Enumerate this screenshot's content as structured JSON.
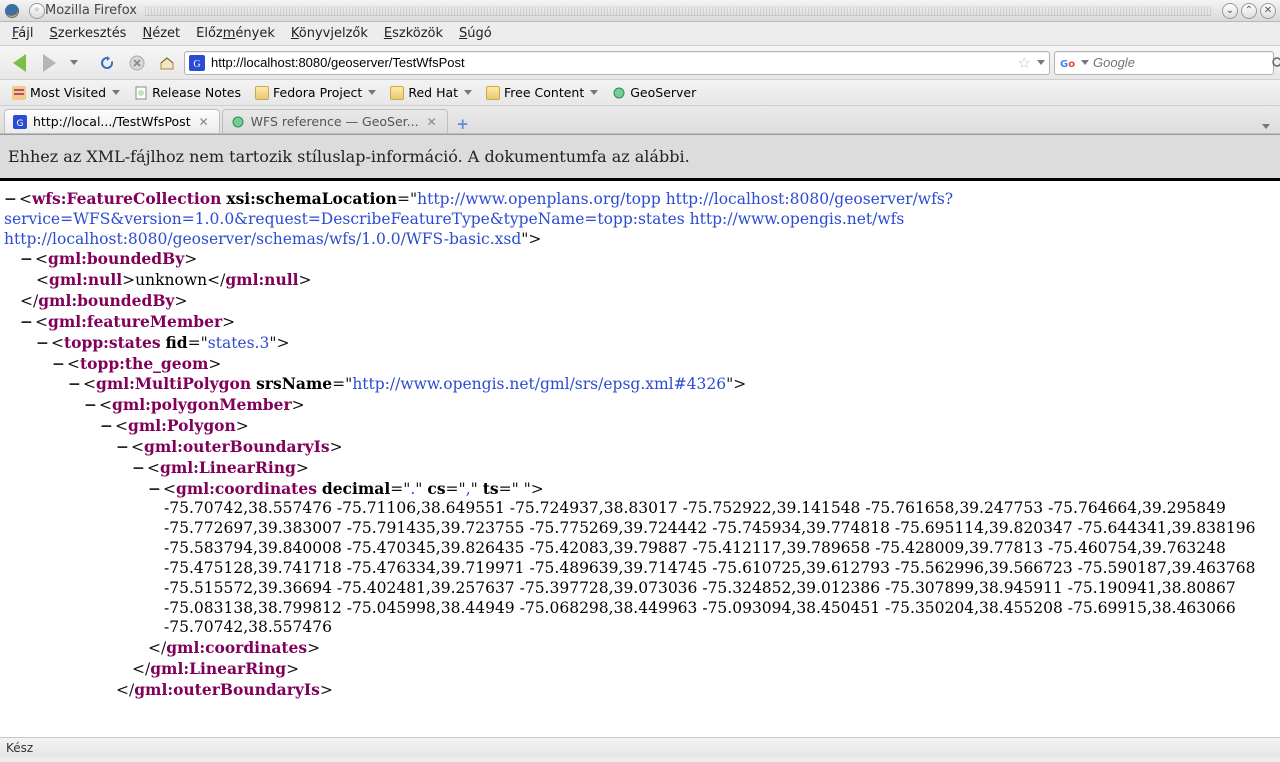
{
  "window": {
    "title": "Mozilla Firefox"
  },
  "menu": {
    "file": "Fájl",
    "edit": "Szerkesztés",
    "view": "Nézet",
    "history": "Előzmények",
    "bookmarks": "Könyvjelzők",
    "tools": "Eszközök",
    "help": "Súgó"
  },
  "url": "http://localhost:8080/geoserver/TestWfsPost",
  "search": {
    "placeholder": "Google"
  },
  "bookmarks": {
    "mostVisited": "Most Visited",
    "releaseNotes": "Release Notes",
    "fedora": "Fedora Project",
    "redHat": "Red Hat",
    "freeContent": "Free Content",
    "geoserver": "GeoServer"
  },
  "tabs": {
    "list": [
      {
        "label": "http://local.../TestWfsPost",
        "active": true
      },
      {
        "label": "WFS reference — GeoSer...",
        "active": false
      }
    ]
  },
  "banner": "Ehhez az XML-fájlhoz nem tartozik stíluslap-információ. A dokumentumfa az alábbi.",
  "xml": {
    "root": {
      "tag": "wfs:FeatureCollection",
      "attrName": "xsi:schemaLocation",
      "attrVal": "http://www.openplans.org/topp http://localhost:8080/geoserver/wfs?service=WFS&version=1.0.0&request=DescribeFeatureType&typeName=topp:states http://www.opengis.net/wfs http://localhost:8080/geoserver/schemas/wfs/1.0.0/WFS-basic.xsd"
    },
    "boundedByOpen": "gml:boundedBy",
    "null": {
      "tag": "gml:null",
      "text": "unknown"
    },
    "boundedByClose": "gml:boundedBy",
    "featureMember": "gml:featureMember",
    "toppStates": {
      "tag": "topp:states",
      "attrName": "fid",
      "attrVal": "states.3"
    },
    "theGeom": "topp:the_geom",
    "multiPolygon": {
      "tag": "gml:MultiPolygon",
      "attrName": "srsName",
      "attrVal": "http://www.opengis.net/gml/srs/epsg.xml#4326"
    },
    "polygonMember": "gml:polygonMember",
    "polygon": "gml:Polygon",
    "outerBoundaryIs": "gml:outerBoundaryIs",
    "linearRing": "gml:LinearRing",
    "coordinates": {
      "tag": "gml:coordinates",
      "attrs": {
        "decimal": ".",
        "cs": ",",
        "ts": " "
      },
      "text": "-75.70742,38.557476 -75.71106,38.649551 -75.724937,38.83017 -75.752922,39.141548 -75.761658,39.247753 -75.764664,39.295849 -75.772697,39.383007 -75.791435,39.723755 -75.775269,39.724442 -75.745934,39.774818 -75.695114,39.820347 -75.644341,39.838196 -75.583794,39.840008 -75.470345,39.826435 -75.42083,39.79887 -75.412117,39.789658 -75.428009,39.77813 -75.460754,39.763248 -75.475128,39.741718 -75.476334,39.719971 -75.489639,39.714745 -75.610725,39.612793 -75.562996,39.566723 -75.590187,39.463768 -75.515572,39.36694 -75.402481,39.257637 -75.397728,39.073036 -75.324852,39.012386 -75.307899,38.945911 -75.190941,38.80867 -75.083138,38.799812 -75.045998,38.44949 -75.068298,38.449963 -75.093094,38.450451 -75.350204,38.455208 -75.69915,38.463066 -75.70742,38.557476"
    },
    "closeCoordinates": "gml:coordinates",
    "closeLinearRing": "gml:LinearRing",
    "closeOuterBoundaryIs": "gml:outerBoundaryIs"
  },
  "status": "Kész"
}
